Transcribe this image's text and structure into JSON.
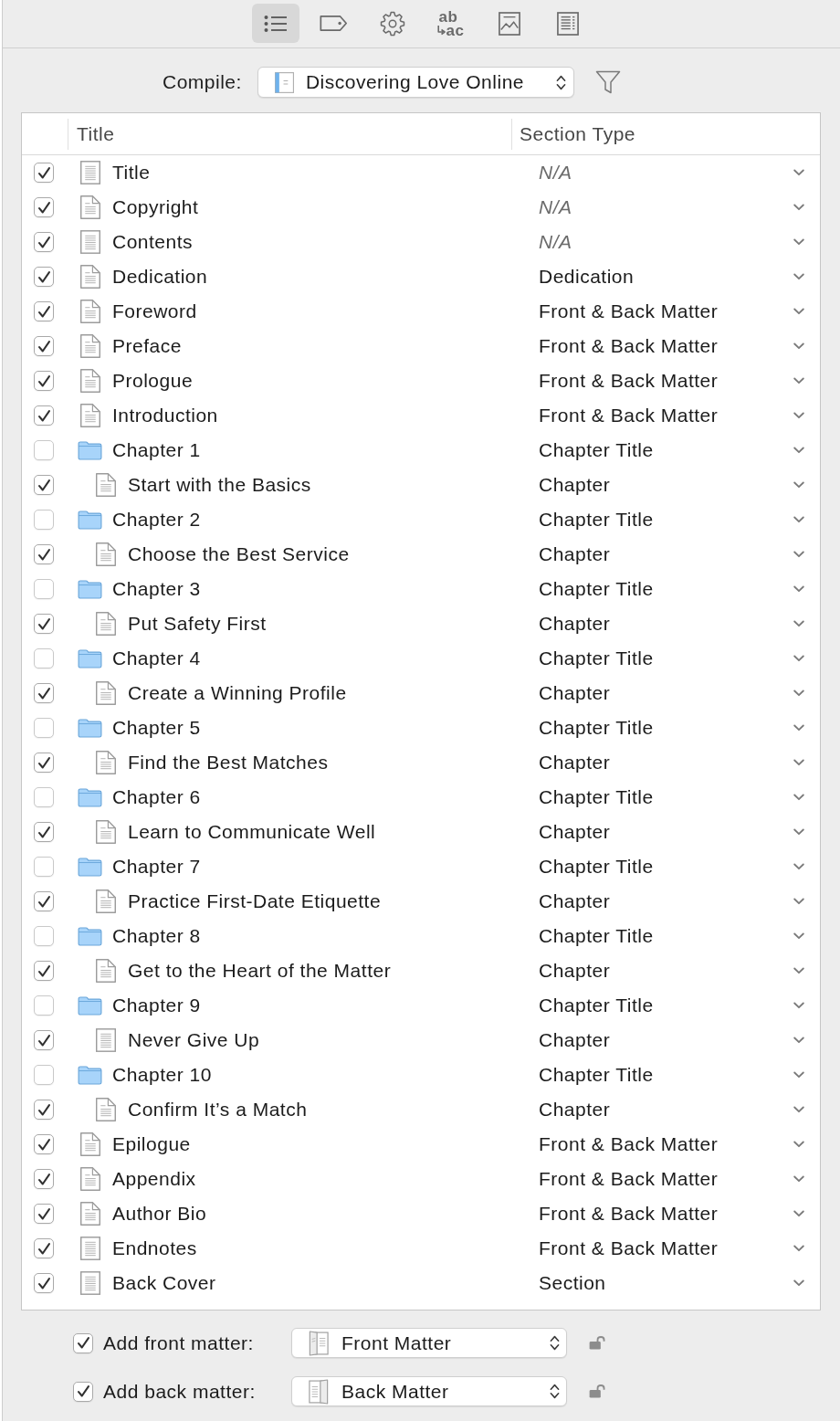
{
  "toolbar_tabs": [
    {
      "kind": "list",
      "selected": true
    },
    {
      "kind": "tag",
      "selected": false
    },
    {
      "kind": "gear",
      "selected": false
    },
    {
      "kind": "replace",
      "selected": false,
      "text_top": "ab",
      "text_bottom": "ac"
    },
    {
      "kind": "picture",
      "selected": false
    },
    {
      "kind": "page",
      "selected": false
    }
  ],
  "compile": {
    "label": "Compile:",
    "value": "Discovering Love Online"
  },
  "table": {
    "columns": [
      "Title",
      "Section Type"
    ],
    "rows": [
      {
        "title": "Title",
        "kind": "lined",
        "checked": true,
        "section_type": "N/A",
        "not_applicable": true
      },
      {
        "title": "Copyright",
        "kind": "page",
        "checked": true,
        "section_type": "N/A",
        "not_applicable": true
      },
      {
        "title": "Contents",
        "kind": "lined",
        "checked": true,
        "section_type": "N/A",
        "not_applicable": true
      },
      {
        "title": "Dedication",
        "kind": "page",
        "checked": true,
        "section_type": "Dedication",
        "not_applicable": false
      },
      {
        "title": "Foreword",
        "kind": "page",
        "checked": true,
        "section_type": "Front & Back Matter",
        "not_applicable": false
      },
      {
        "title": "Preface",
        "kind": "page",
        "checked": true,
        "section_type": "Front & Back Matter",
        "not_applicable": false
      },
      {
        "title": "Prologue",
        "kind": "page",
        "checked": true,
        "section_type": "Front & Back Matter",
        "not_applicable": false
      },
      {
        "title": "Introduction",
        "kind": "page",
        "checked": true,
        "section_type": "Front & Back Matter",
        "not_applicable": false
      },
      {
        "title": "Chapter 1",
        "kind": "folder",
        "checked": false,
        "section_type": "Chapter Title",
        "not_applicable": false,
        "children": [
          {
            "title": "Start with the Basics",
            "kind": "page",
            "checked": true,
            "section_type": "Chapter",
            "not_applicable": false
          }
        ]
      },
      {
        "title": "Chapter 2",
        "kind": "folder",
        "checked": false,
        "section_type": "Chapter Title",
        "not_applicable": false,
        "children": [
          {
            "title": "Choose the Best Service",
            "kind": "page",
            "checked": true,
            "section_type": "Chapter",
            "not_applicable": false
          }
        ]
      },
      {
        "title": "Chapter 3",
        "kind": "folder",
        "checked": false,
        "section_type": "Chapter Title",
        "not_applicable": false,
        "children": [
          {
            "title": "Put Safety First",
            "kind": "page",
            "checked": true,
            "section_type": "Chapter",
            "not_applicable": false
          }
        ]
      },
      {
        "title": "Chapter 4",
        "kind": "folder",
        "checked": false,
        "section_type": "Chapter Title",
        "not_applicable": false,
        "children": [
          {
            "title": "Create a Winning Profile",
            "kind": "page",
            "checked": true,
            "section_type": "Chapter",
            "not_applicable": false
          }
        ]
      },
      {
        "title": "Chapter 5",
        "kind": "folder",
        "checked": false,
        "section_type": "Chapter Title",
        "not_applicable": false,
        "children": [
          {
            "title": "Find the Best Matches",
            "kind": "page",
            "checked": true,
            "section_type": "Chapter",
            "not_applicable": false
          }
        ]
      },
      {
        "title": "Chapter 6",
        "kind": "folder",
        "checked": false,
        "section_type": "Chapter Title",
        "not_applicable": false,
        "children": [
          {
            "title": "Learn to Communicate Well",
            "kind": "page",
            "checked": true,
            "section_type": "Chapter",
            "not_applicable": false
          }
        ]
      },
      {
        "title": "Chapter 7",
        "kind": "folder",
        "checked": false,
        "section_type": "Chapter Title",
        "not_applicable": false,
        "children": [
          {
            "title": "Practice First-Date Etiquette",
            "kind": "page",
            "checked": true,
            "section_type": "Chapter",
            "not_applicable": false
          }
        ]
      },
      {
        "title": "Chapter 8",
        "kind": "folder",
        "checked": false,
        "section_type": "Chapter Title",
        "not_applicable": false,
        "children": [
          {
            "title": "Get to the Heart of the Matter",
            "kind": "page",
            "checked": true,
            "section_type": "Chapter",
            "not_applicable": false
          }
        ]
      },
      {
        "title": "Chapter 9",
        "kind": "folder",
        "checked": false,
        "section_type": "Chapter Title",
        "not_applicable": false,
        "children": [
          {
            "title": "Never Give Up",
            "kind": "lined",
            "checked": true,
            "section_type": "Chapter",
            "not_applicable": false
          }
        ]
      },
      {
        "title": "Chapter 10",
        "kind": "folder",
        "checked": false,
        "section_type": "Chapter Title",
        "not_applicable": false,
        "children": [
          {
            "title": "Confirm It’s a Match",
            "kind": "page",
            "checked": true,
            "section_type": "Chapter",
            "not_applicable": false
          }
        ]
      },
      {
        "title": "Epilogue",
        "kind": "page",
        "checked": true,
        "section_type": "Front & Back Matter",
        "not_applicable": false
      },
      {
        "title": "Appendix",
        "kind": "page",
        "checked": true,
        "section_type": "Front & Back Matter",
        "not_applicable": false
      },
      {
        "title": "Author Bio",
        "kind": "page",
        "checked": true,
        "section_type": "Front & Back Matter",
        "not_applicable": false
      },
      {
        "title": "Endnotes",
        "kind": "lined",
        "checked": true,
        "section_type": "Front & Back Matter",
        "not_applicable": false
      },
      {
        "title": "Back Cover",
        "kind": "lined",
        "checked": true,
        "section_type": "Section",
        "not_applicable": false
      }
    ]
  },
  "front_matter": {
    "checked": true,
    "label": "Add front matter:",
    "value": "Front Matter"
  },
  "back_matter": {
    "checked": true,
    "label": "Add back matter:",
    "value": "Back Matter"
  }
}
